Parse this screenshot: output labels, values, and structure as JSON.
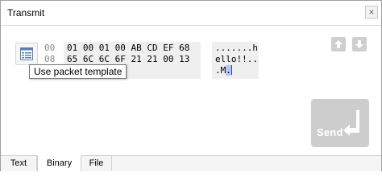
{
  "window": {
    "title": "Transmit",
    "close_glyph": "×"
  },
  "editor": {
    "offsets": [
      "00",
      "08"
    ],
    "hex_lines": [
      "01 00 01 00 AB CD EF 68",
      "65 6C 6C 6F 21 21 00 13"
    ],
    "ascii_lines": [
      ".......h",
      "ello!!..",
      ".M."
    ],
    "ascii_line3_selected": "."
  },
  "template_button": {
    "icon": "table-template-icon",
    "tooltip": "Use packet template"
  },
  "nav_buttons": {
    "up_icon": "arrow-up-icon",
    "down_icon": "arrow-down-icon"
  },
  "send": {
    "label": "Send",
    "icon": "enter-arrow-icon"
  },
  "tabs": [
    {
      "label": "Text",
      "active": false
    },
    {
      "label": "Binary",
      "active": true
    },
    {
      "label": "File",
      "active": false
    }
  ]
}
